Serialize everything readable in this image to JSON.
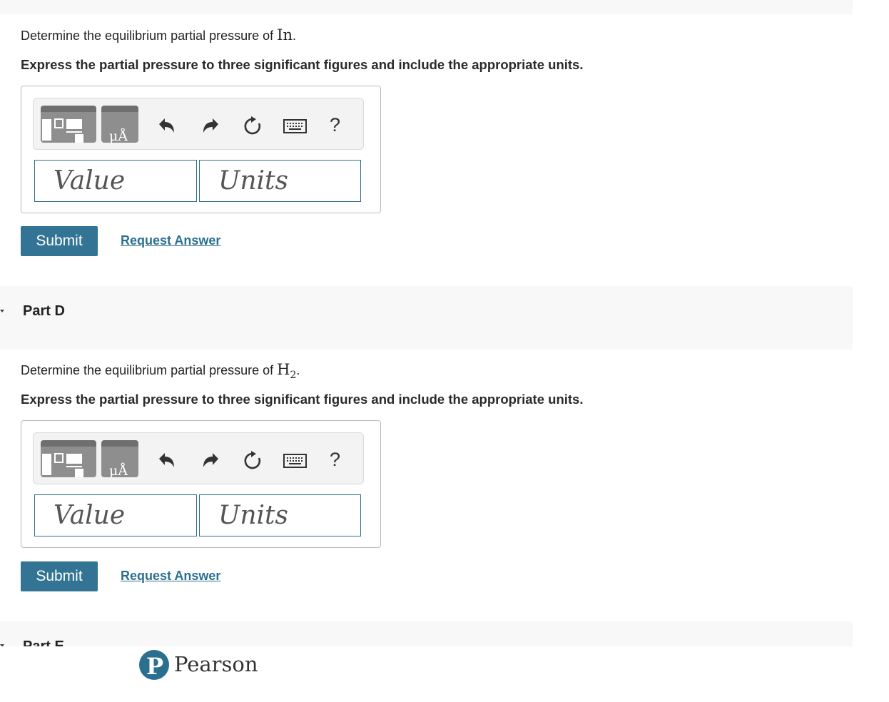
{
  "partC": {
    "question_prefix": "Determine the equilibrium partial pressure of ",
    "species": "In",
    "species_suffix": ".",
    "instruction": "Express the partial pressure to three significant figures and include the appropriate units.",
    "value_placeholder": "Value",
    "units_placeholder": "Units",
    "submit_label": "Submit",
    "request_answer_label": "Request Answer"
  },
  "partD": {
    "title": "Part D",
    "question_prefix": "Determine the equilibrium partial pressure of ",
    "species_base": "H",
    "species_sub": "2",
    "species_suffix": ".",
    "instruction": "Express the partial pressure to three significant figures and include the appropriate units.",
    "value_placeholder": "Value",
    "units_placeholder": "Units",
    "submit_label": "Submit",
    "request_answer_label": "Request Answer"
  },
  "partE": {
    "title": "Part E"
  },
  "toolbar": {
    "units_button_glyph": "μÅ",
    "help_label": "?",
    "icons": [
      "templates-icon",
      "units-icon",
      "undo-icon",
      "redo-icon",
      "reset-icon",
      "keyboard-icon",
      "help-icon"
    ]
  },
  "footer": {
    "brand": "Pearson",
    "logo_letter": "P"
  },
  "colors": {
    "accent": "#337494",
    "link": "#2c7090",
    "field_border": "#2e6f8e",
    "band": "#f8f8f8"
  }
}
